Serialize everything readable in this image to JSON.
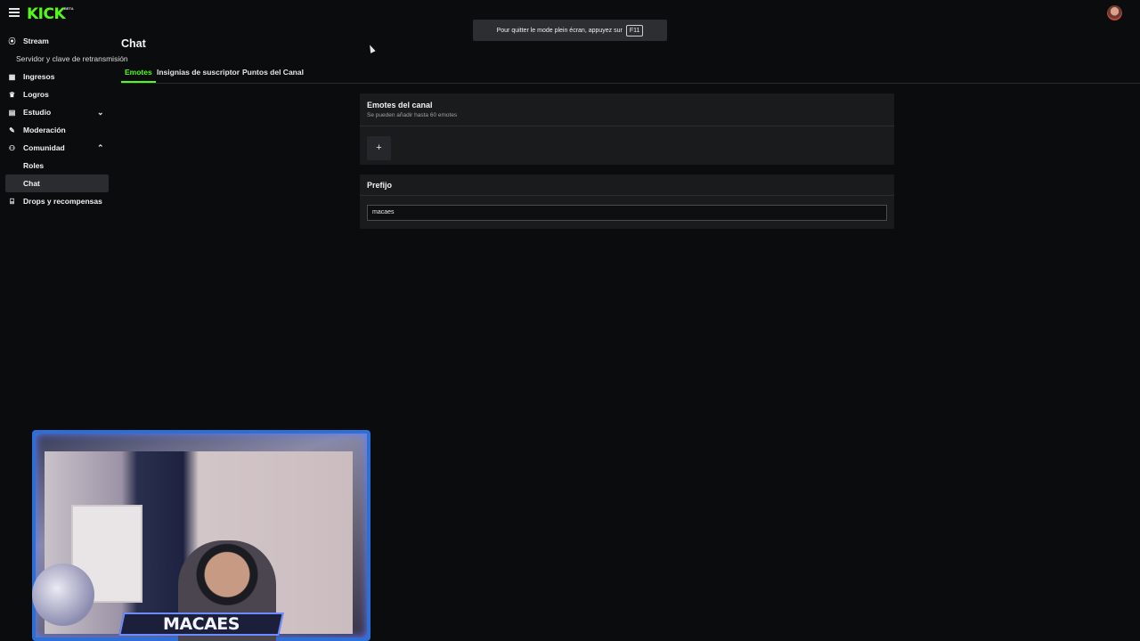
{
  "topbar": {
    "logo": "KICK",
    "logo_badge": "BETA"
  },
  "fullscreen_toast": {
    "text": "Pour quitter le mode plein écran, appuyez sur",
    "key": "F11"
  },
  "sidebar": {
    "items": [
      {
        "label": "Stream",
        "icon": "stream-icon"
      },
      {
        "label": "Servidor y clave de retransmisión",
        "icon": ""
      },
      {
        "label": "Ingresos",
        "icon": "revenue-icon"
      },
      {
        "label": "Logros",
        "icon": "trophy-icon"
      },
      {
        "label": "Estudio",
        "icon": "studio-icon",
        "chevron": "down"
      },
      {
        "label": "Moderación",
        "icon": "wrench-icon"
      },
      {
        "label": "Comunidad",
        "icon": "community-icon",
        "chevron": "up"
      },
      {
        "label": "Roles",
        "icon": ""
      },
      {
        "label": "Chat",
        "icon": "",
        "active": true
      },
      {
        "label": "Drops y recompensas",
        "icon": "gift-icon"
      }
    ]
  },
  "page": {
    "title": "Chat",
    "tabs": [
      {
        "label": "Emotes",
        "active": true
      },
      {
        "label": "Insignias de suscriptor"
      },
      {
        "label": "Puntos del Canal"
      }
    ]
  },
  "emotes_card": {
    "title": "Emotes del canal",
    "subtitle": "Se pueden añadir hasta 60 emotes",
    "add_label": "+"
  },
  "prefix_card": {
    "title": "Prefijo",
    "value": "macaes"
  },
  "webcam": {
    "name": "MACAES"
  },
  "colors": {
    "accent": "#53fc18",
    "background": "#0b0c0d",
    "card": "#1a1b1d"
  }
}
